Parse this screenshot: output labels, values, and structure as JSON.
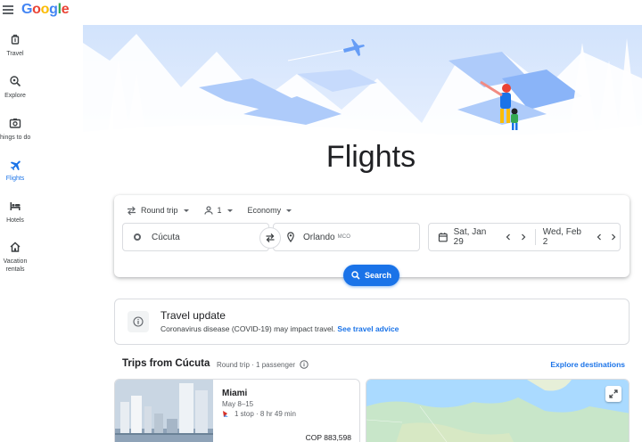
{
  "header": {
    "logo": {
      "letters": [
        "G",
        "o",
        "o",
        "g",
        "l",
        "e"
      ]
    }
  },
  "sidenav": {
    "items": [
      {
        "label": "Travel",
        "icon": "suitcase-icon",
        "active": false
      },
      {
        "label": "Explore",
        "icon": "explore-icon",
        "active": false
      },
      {
        "label": "hings to do",
        "icon": "camera-icon",
        "active": false
      },
      {
        "label": "Flights",
        "icon": "plane-icon",
        "active": true
      },
      {
        "label": "Hotels",
        "icon": "bed-icon",
        "active": false
      },
      {
        "label_lines": [
          "Vacation",
          "rentals"
        ],
        "icon": "house-icon",
        "active": false
      }
    ]
  },
  "page": {
    "title": "Flights"
  },
  "search": {
    "trip_type": "Round trip",
    "passengers": "1",
    "cabin": "Economy",
    "origin": "Cúcuta",
    "destination": "Orlando",
    "destination_code": "MCO",
    "depart_date": "Sat, Jan 29",
    "return_date": "Wed, Feb 2",
    "button_label": "Search"
  },
  "update": {
    "title": "Travel update",
    "text": "Coronavirus disease (COVID-19) may impact travel.",
    "link": "See travel advice"
  },
  "trips": {
    "title": "Trips from Cúcuta",
    "subtitle": "Round trip · 1 passenger",
    "explore_link": "Explore destinations",
    "cards": [
      {
        "city": "Miami",
        "dates": "May 8–15",
        "stops": "1 stop · 8 hr 49 min",
        "price": "COP 883,598"
      }
    ]
  },
  "colors": {
    "accent": "#1a73e8",
    "text": "#202124",
    "muted": "#5f6368",
    "border": "#dadce0"
  }
}
